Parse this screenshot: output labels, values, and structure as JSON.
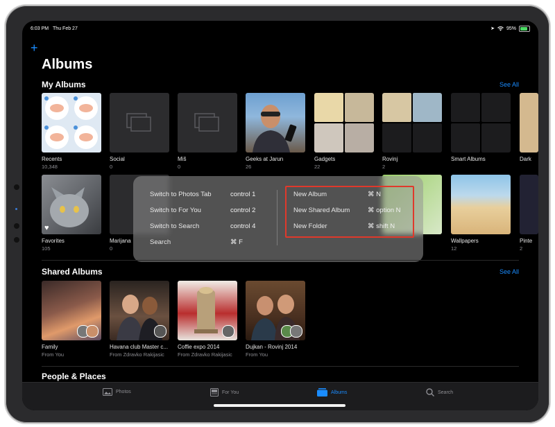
{
  "status": {
    "time": "6:03 PM",
    "date": "Thu Feb 27",
    "battery": "95%"
  },
  "header": {
    "title": "Albums"
  },
  "my_albums": {
    "title": "My Albums",
    "see_all": "See All",
    "row1": [
      {
        "name": "Recents",
        "count": "10,348"
      },
      {
        "name": "Social",
        "count": "0"
      },
      {
        "name": "Miš",
        "count": "0"
      },
      {
        "name": "Geeks at Jarun",
        "count": "26"
      },
      {
        "name": "Gadgets",
        "count": "22"
      },
      {
        "name": "Rovinj",
        "count": "2"
      },
      {
        "name": "Smart Albums",
        "count": ""
      },
      {
        "name": "Dark",
        "count": ""
      }
    ],
    "row2": [
      {
        "name": "Favorites",
        "count": "105"
      },
      {
        "name": "Marijana",
        "count": "0"
      },
      {
        "name": "Wallpapers",
        "count": "12"
      },
      {
        "name": "Pinte",
        "count": "2"
      }
    ]
  },
  "shared_albums": {
    "title": "Shared Albums",
    "see_all": "See All",
    "items": [
      {
        "name": "Family",
        "from": "From You"
      },
      {
        "name": "Havana club Master c...",
        "from": "From Zdravko Rakijasic"
      },
      {
        "name": "Coffie expo 2014",
        "from": "From Zdravko Rakijasic"
      },
      {
        "name": "Dujkan - Rovinj 2014",
        "from": "From You"
      }
    ]
  },
  "people_places": {
    "title": "People & Places"
  },
  "shortcuts": {
    "left": [
      {
        "label": "Switch to Photos Tab",
        "key": "control 1"
      },
      {
        "label": "Switch to For You",
        "key": "control 2"
      },
      {
        "label": "Switch to Search",
        "key": "control 4"
      },
      {
        "label": "Search",
        "key": "⌘ F"
      }
    ],
    "right": [
      {
        "label": "New Album",
        "key": "⌘ N"
      },
      {
        "label": "New Shared Album",
        "key": "⌘ option N"
      },
      {
        "label": "New Folder",
        "key": "⌘ shift N"
      }
    ]
  },
  "tabs": [
    {
      "label": "Photos",
      "icon": "photos-icon"
    },
    {
      "label": "For You",
      "icon": "for-you-icon"
    },
    {
      "label": "Albums",
      "icon": "albums-icon",
      "active": true
    },
    {
      "label": "Search",
      "icon": "search-icon"
    }
  ],
  "colors": {
    "accent": "#1a8cff",
    "highlight": "#e0392b"
  }
}
